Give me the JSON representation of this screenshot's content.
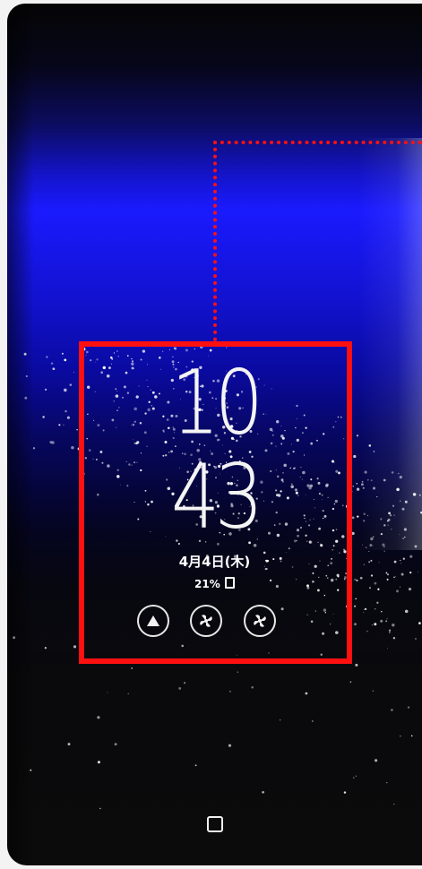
{
  "always_on_display": {
    "clock": {
      "hour": "10",
      "minute": "43"
    },
    "date": "4月4日(木)",
    "battery": "21%",
    "notifications": [
      {
        "icon": "triangle-icon"
      },
      {
        "icon": "fan-icon"
      },
      {
        "icon": "fan-icon"
      }
    ]
  },
  "navigation": {
    "recents_icon": "recents-icon"
  },
  "colors": {
    "highlight": "#ff1010",
    "background_blue": "#1a1aff",
    "text": "#ffffff"
  }
}
